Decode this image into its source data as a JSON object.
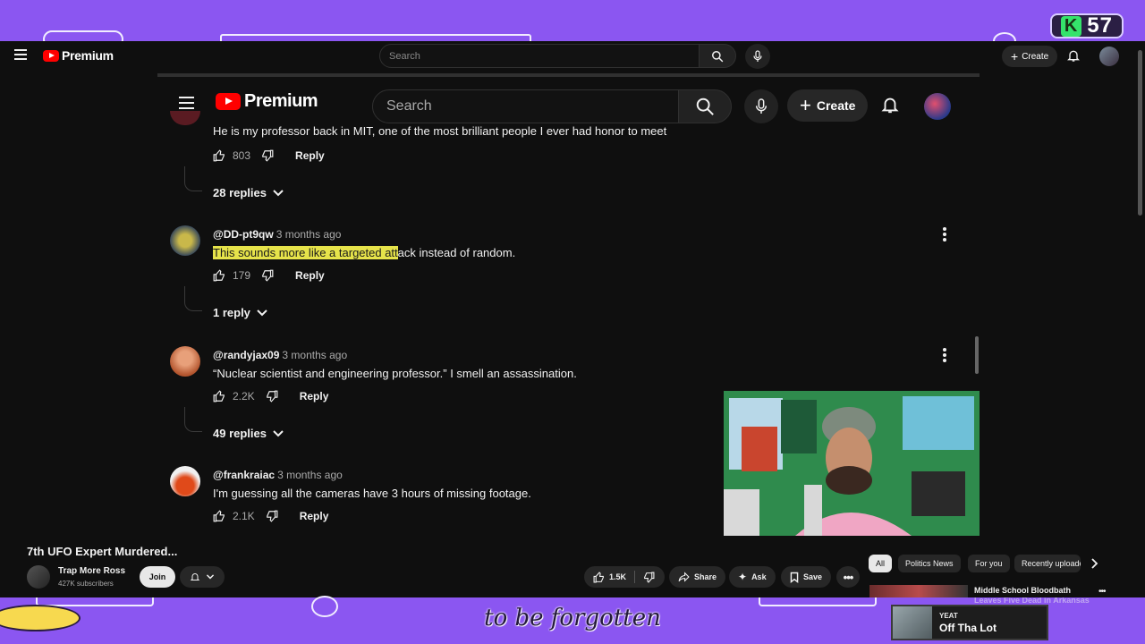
{
  "overlay": {
    "badge_letter": "K",
    "badge_number": "57",
    "subtitle": "to be forgotten",
    "now_playing": {
      "artist": "YEAT",
      "track": "Off Tha Lot"
    }
  },
  "outer": {
    "brand": "Premium",
    "search_placeholder": "Search",
    "create_label": "Create",
    "video_title": "7th UFO Expert Murdered...",
    "channel_name": "Trap More Ross",
    "channel_subs": "427K subscribers",
    "join_label": "Join",
    "like_count": "1.5K",
    "share_label": "Share",
    "ask_label": "Ask",
    "save_label": "Save",
    "chips": [
      "All",
      "Politics News",
      "For you",
      "Recently uploaded"
    ],
    "recommended_title": "Middle School Bloodbath",
    "recommended_title_line2": "Leaves Five Dead in Arkansas"
  },
  "inner": {
    "brand": "Premium",
    "search_placeholder": "Search",
    "create_label": "Create",
    "comments": [
      {
        "text": "He is my professor back in MIT, one of the most brilliant people I ever had honor to meet",
        "likes": "803",
        "reply_label": "Reply",
        "replies": "28 replies"
      },
      {
        "author": "@DD-pt9qw",
        "time": "3 months ago",
        "text_highlighted": "This sounds more like a targeted att",
        "text_rest": "ack instead of random.",
        "likes": "179",
        "reply_label": "Reply",
        "replies": "1 reply"
      },
      {
        "author": "@randyjax09",
        "time": "3 months ago",
        "text": "“Nuclear scientist and engineering professor.” I smell an assassination.",
        "likes": "2.2K",
        "reply_label": "Reply",
        "replies": "49 replies"
      },
      {
        "author": "@frankraiac",
        "time": "3 months ago",
        "text": "I'm guessing all the cameras have 3 hours of missing footage.",
        "likes": "2.1K",
        "reply_label": "Reply"
      }
    ]
  },
  "colors": {
    "frame_purple": "#8b56f1",
    "youtube_red": "#ff0000",
    "highlight_yellow": "#e6e34a",
    "bg_dark": "#0f0f0f"
  },
  "icons": [
    "menu-icon",
    "youtube-logo-icon",
    "search-icon",
    "mic-icon",
    "plus-icon",
    "bell-icon",
    "thumbs-up-icon",
    "thumbs-down-icon",
    "chevron-down-icon",
    "more-vert-icon",
    "share-icon",
    "sparkle-icon",
    "bookmark-icon",
    "chevron-right-icon"
  ]
}
